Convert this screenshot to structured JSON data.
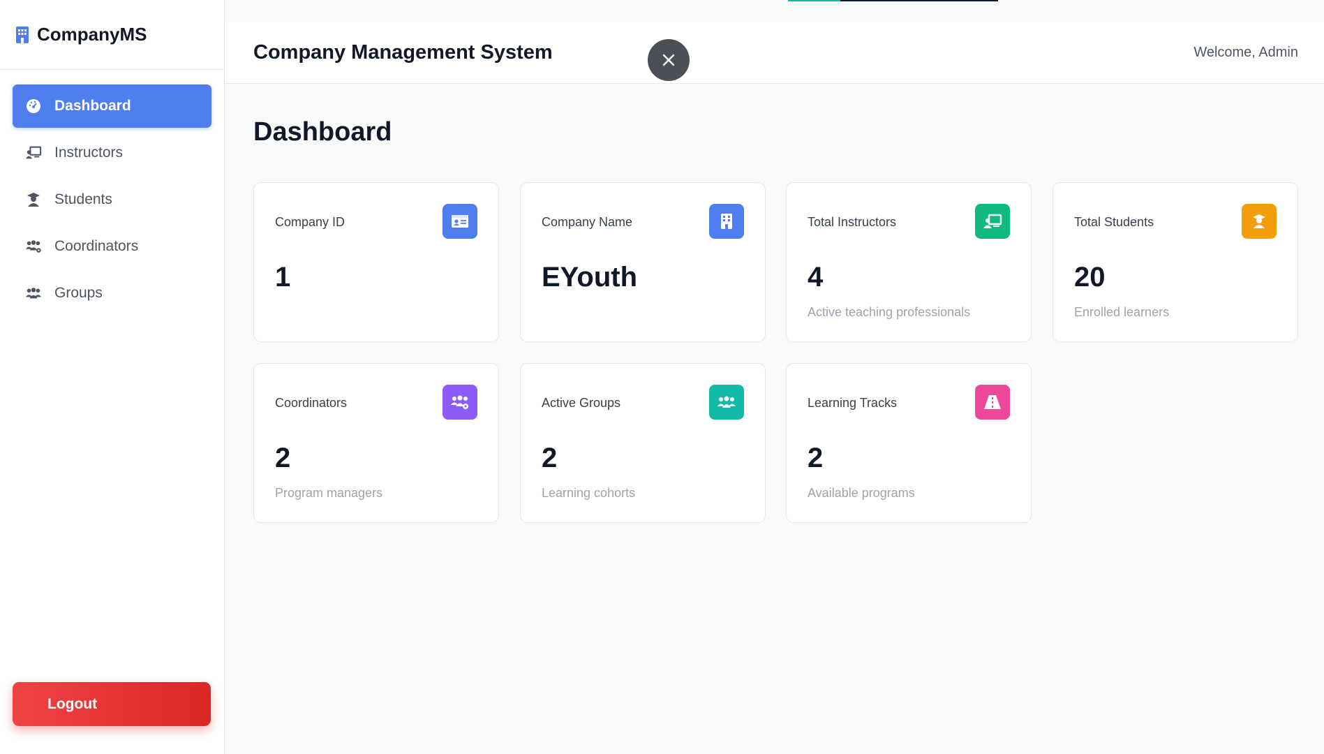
{
  "brand": {
    "name": "CompanyMS"
  },
  "sidebar": {
    "items": [
      {
        "label": "Dashboard",
        "icon": "dashboard-gauge-icon",
        "active": true
      },
      {
        "label": "Instructors",
        "icon": "instructor-icon"
      },
      {
        "label": "Students",
        "icon": "student-icon"
      },
      {
        "label": "Coordinators",
        "icon": "coordinators-icon"
      },
      {
        "label": "Groups",
        "icon": "groups-icon"
      }
    ],
    "logout_label": "Logout"
  },
  "header": {
    "title": "Company Management System",
    "welcome": "Welcome, Admin"
  },
  "main": {
    "title": "Dashboard",
    "cards": [
      {
        "label": "Company ID",
        "value": "1",
        "sub": "",
        "icon": "id-card-icon",
        "color": "#4f7ef0"
      },
      {
        "label": "Company Name",
        "value": "EYouth",
        "sub": "",
        "icon": "building-icon",
        "color": "#4f7ef0"
      },
      {
        "label": "Total Instructors",
        "value": "4",
        "sub": "Active teaching professionals",
        "icon": "instructor-icon",
        "color": "#10b981"
      },
      {
        "label": "Total Students",
        "value": "20",
        "sub": "Enrolled learners",
        "icon": "student-icon",
        "color": "#f59e0b"
      },
      {
        "label": "Coordinators",
        "value": "2",
        "sub": "Program managers",
        "icon": "coordinators-icon",
        "color": "#8b5cf6"
      },
      {
        "label": "Active Groups",
        "value": "2",
        "sub": "Learning cohorts",
        "icon": "groups-icon",
        "color": "#14b8a6"
      },
      {
        "label": "Learning Tracks",
        "value": "2",
        "sub": "Available programs",
        "icon": "road-icon",
        "color": "#ec4899"
      }
    ]
  },
  "colors": {
    "accent": "#4f7ef0",
    "danger": "#dc2626",
    "progress": "#14b8a6"
  },
  "loading_progress": 0.25
}
